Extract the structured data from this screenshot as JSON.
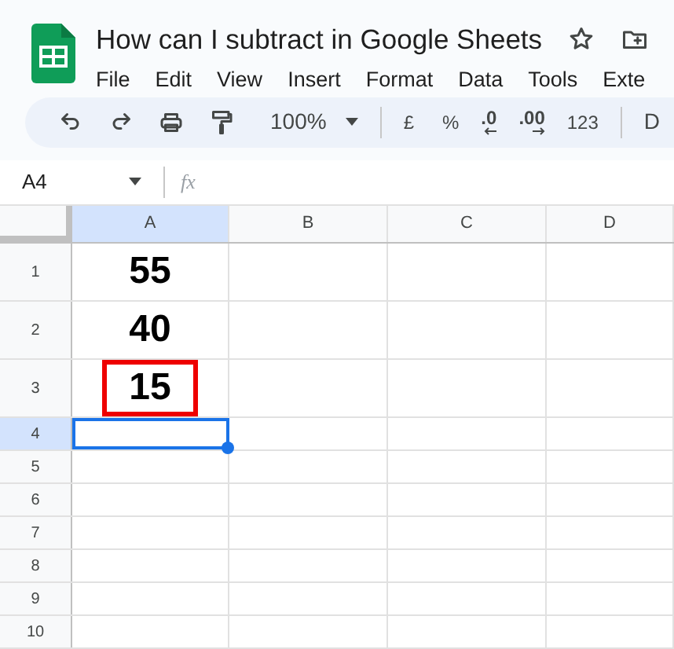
{
  "document": {
    "title": "How can I subtract in Google Sheets"
  },
  "menu": [
    "File",
    "Edit",
    "View",
    "Insert",
    "Format",
    "Data",
    "Tools",
    "Exte"
  ],
  "toolbar": {
    "zoom": "100%",
    "currency": "£",
    "percent": "%",
    "decrease_decimals": ".0",
    "increase_decimals": ".00",
    "number_format": "123",
    "font_cut": "D"
  },
  "formula_bar": {
    "cell_ref": "A4",
    "function_label": "fx"
  },
  "grid": {
    "columns": [
      {
        "label": "A",
        "selected": true
      },
      {
        "label": "B",
        "selected": false
      },
      {
        "label": "C",
        "selected": false
      },
      {
        "label": "D",
        "selected": false
      }
    ],
    "rows": [
      {
        "label": "1",
        "selected": false,
        "cells": [
          {
            "value": "55",
            "outlined": false
          }
        ]
      },
      {
        "label": "2",
        "selected": false,
        "cells": [
          {
            "value": "40",
            "outlined": false
          }
        ]
      },
      {
        "label": "3",
        "selected": false,
        "cells": [
          {
            "value": "15",
            "outlined": true
          }
        ]
      },
      {
        "label": "4",
        "selected": true,
        "cells": [
          {
            "active": true
          }
        ]
      },
      {
        "label": "5",
        "selected": false,
        "cells": []
      },
      {
        "label": "6",
        "selected": false,
        "cells": []
      },
      {
        "label": "7",
        "selected": false,
        "cells": []
      },
      {
        "label": "8",
        "selected": false,
        "cells": []
      },
      {
        "label": "9",
        "selected": false,
        "cells": []
      },
      {
        "label": "10",
        "selected": false,
        "cells": []
      }
    ]
  }
}
